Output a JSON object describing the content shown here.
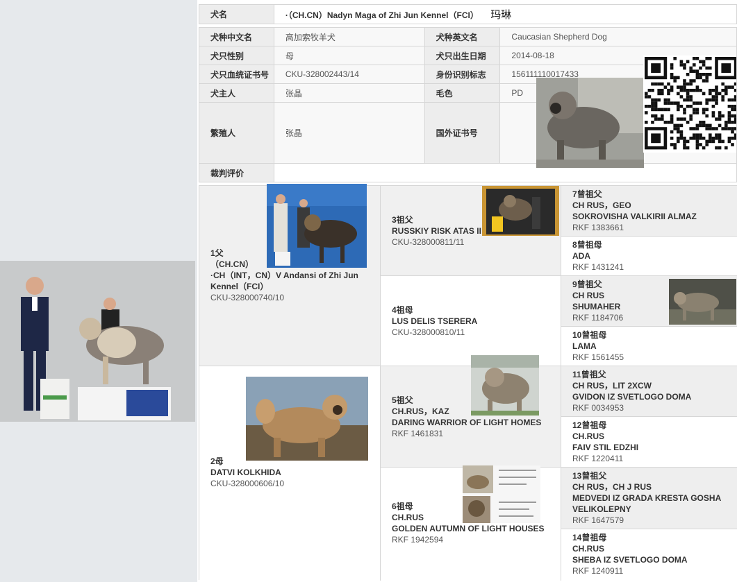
{
  "info": {
    "dog_name_label": "犬名",
    "dog_name": "·（CH.CN）Nadyn Maga of Zhi Jun Kennel（FCI）",
    "dog_name_cn": "玛琳",
    "breed_cn_label": "犬种中文名",
    "breed_cn": "高加索牧羊犬",
    "breed_en_label": "犬种英文名",
    "breed_en": "Caucasian Shepherd Dog",
    "sex_label": "犬只性别",
    "sex": "母",
    "dob_label": "犬只出生日期",
    "dob": "2014-08-18",
    "reg_label": "犬只血统证书号",
    "reg": "CKU-328002443/14",
    "chip_label": "身份识别标志",
    "chip": "156111110017433",
    "owner_label": "犬主人",
    "owner": "张晶",
    "color_label": "毛色",
    "color": "PD",
    "breeder_label": "繁殖人",
    "breeder": "张晶",
    "foreign_label": "国外证书号",
    "foreign": "",
    "judge_label": "裁判评价",
    "judge": ""
  },
  "pedigree": {
    "sire": {
      "label": "1父",
      "title1": "（CH.CN）",
      "title2": "·CH（INT，CN）V Andansi of Zhi Jun Kennel（FCI）",
      "reg": "CKU-328000740/10"
    },
    "dam": {
      "label": "2母",
      "title1": "DATVI KOLKHIDA",
      "reg": "CKU-328000606/10"
    },
    "g3": {
      "label": "3祖父",
      "name": "RUSSKIY RISK ATAS II",
      "reg": "CKU-328000811/11"
    },
    "g4": {
      "label": "4祖母",
      "name": "LUS DELIS TSERERA",
      "reg": "CKU-328000810/11"
    },
    "g5": {
      "label": "5祖父",
      "title": "CH.RUS，KAZ",
      "name": "DARING WARRIOR OF LIGHT HOMES",
      "reg": "RKF 1461831"
    },
    "g6": {
      "label": "6祖母",
      "title": "CH.RUS",
      "name": "GOLDEN AUTUMN OF LIGHT HOUSES",
      "reg": "RKF 1942594"
    },
    "gg7": {
      "label": "7曾祖父",
      "title": "CH RUS，GEO",
      "name": "SOKROVISHA VALKIRII ALMAZ",
      "reg": "RKF 1383661"
    },
    "gg8": {
      "label": "8曾祖母",
      "name": "ADA",
      "reg": "RKF 1431241"
    },
    "gg9": {
      "label": "9曾祖父",
      "title": "CH RUS",
      "name": "SHUMAHER",
      "reg": "RKF 1184706"
    },
    "gg10": {
      "label": "10曾祖母",
      "name": "LAMA",
      "reg": "RKF 1561455"
    },
    "gg11": {
      "label": "11曾祖父",
      "title": "CH RUS，LIT 2XCW",
      "name": "GVIDON IZ SVETLOGO DOMA",
      "reg": "RKF 0034953"
    },
    "gg12": {
      "label": "12曾祖母",
      "title": "CH.RUS",
      "name": "FAIV STIL EDZHI",
      "reg": "RKF 1220411"
    },
    "gg13": {
      "label": "13曾祖父",
      "title": "CH RUS，CH J RUS",
      "name": "MEDVEDI IZ GRADA KRESTA GOSHA VELIKOLEPNY",
      "reg": "RKF 1647579"
    },
    "gg14": {
      "label": "14曾祖母",
      "title": "CH.RUS",
      "name": "SHEBA IZ SVETLOGO DOMA",
      "reg": "RKF 1240911"
    }
  },
  "colors": {
    "label_bg": "#ededed",
    "border": "#d6d6d6",
    "page_bg": "#e6e9ec"
  }
}
